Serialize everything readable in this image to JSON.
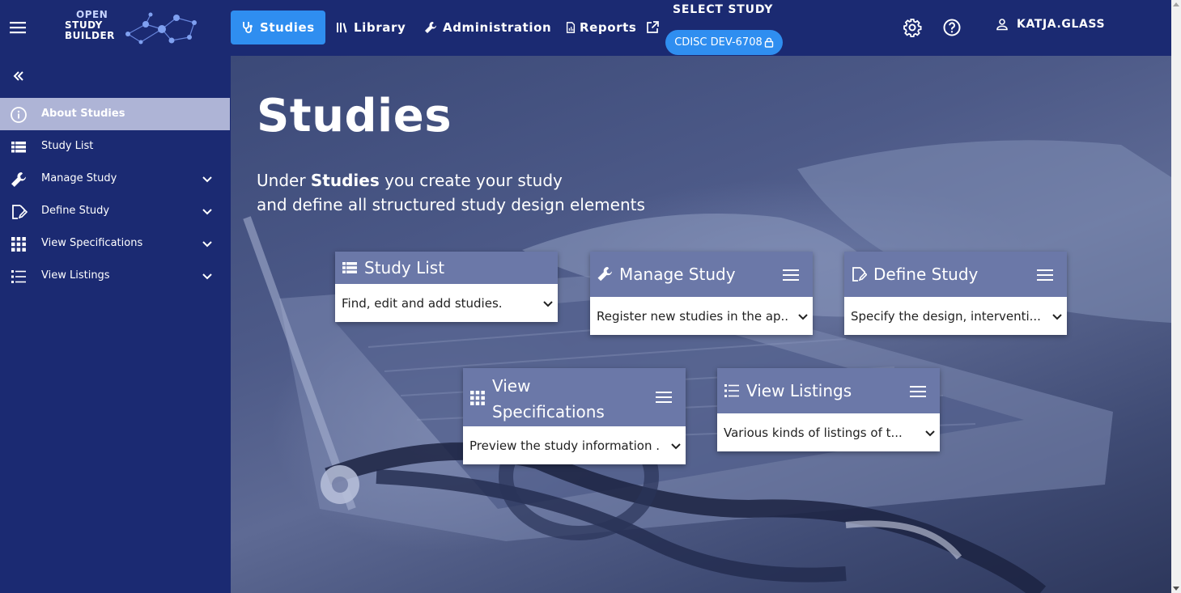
{
  "topbar": {
    "logo_lines": [
      "OPEN",
      "STUDY",
      "BUILDER"
    ],
    "nav": {
      "studies": "Studies",
      "library": "Library",
      "administration": "Administration",
      "reports": "Reports"
    },
    "select_study_label": "SELECT STUDY",
    "study_chip": "CDISC DEV-6708",
    "user": "KATJA.GLASS"
  },
  "sidebar": {
    "items": [
      {
        "label": "About Studies",
        "active": true
      },
      {
        "label": "Study List"
      },
      {
        "label": "Manage Study",
        "expandable": true
      },
      {
        "label": "Define Study",
        "expandable": true
      },
      {
        "label": "View Specifications",
        "expandable": true
      },
      {
        "label": "View Listings",
        "expandable": true
      }
    ]
  },
  "main": {
    "title": "Studies",
    "subtitle": {
      "prefix": "Under ",
      "bold": "Studies",
      "suffix": " you create your study",
      "line2": "and define all structured study design elements"
    },
    "cards": {
      "study_list": {
        "title": "Study List",
        "description": "Find, edit and add studies."
      },
      "manage_study": {
        "title": "Manage Study",
        "description": "Register new studies in the ap..."
      },
      "define_study": {
        "title": "Define Study",
        "description": "Specify the design, interventi..."
      },
      "view_specifications": {
        "title_line1": "View",
        "title_line2": "Specifications",
        "description": "Preview the study information ..."
      },
      "view_listings": {
        "title": "View Listings",
        "description": "Various kinds of listings of t..."
      }
    }
  },
  "colors": {
    "topbar_bg": "#1b2a72",
    "accent": "#2f8ef0",
    "sidebar_active": "#aeb4d6",
    "card_header": "#6b78a8"
  }
}
